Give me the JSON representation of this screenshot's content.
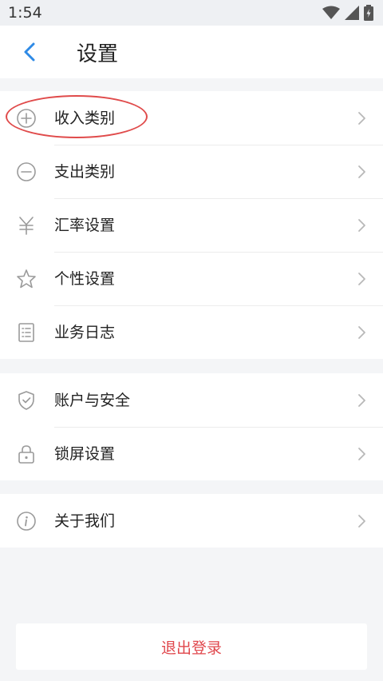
{
  "status_bar": {
    "time": "1:54"
  },
  "header": {
    "title": "设置"
  },
  "groups": [
    {
      "items": [
        {
          "label": "收入类别",
          "icon": "plus-circle-icon"
        },
        {
          "label": "支出类别",
          "icon": "minus-circle-icon"
        },
        {
          "label": "汇率设置",
          "icon": "yen-icon"
        },
        {
          "label": "个性设置",
          "icon": "star-outline-icon"
        },
        {
          "label": "业务日志",
          "icon": "list-document-icon"
        }
      ]
    },
    {
      "items": [
        {
          "label": "账户与安全",
          "icon": "shield-check-icon"
        },
        {
          "label": "锁屏设置",
          "icon": "lock-icon"
        }
      ]
    },
    {
      "items": [
        {
          "label": "关于我们",
          "icon": "info-circle-icon"
        }
      ]
    }
  ],
  "logout": {
    "label": "退出登录"
  },
  "colors": {
    "accent": "#2e8ae6",
    "danger": "#e0474c",
    "highlight": "#e04b4b",
    "background": "#f4f5f7"
  }
}
